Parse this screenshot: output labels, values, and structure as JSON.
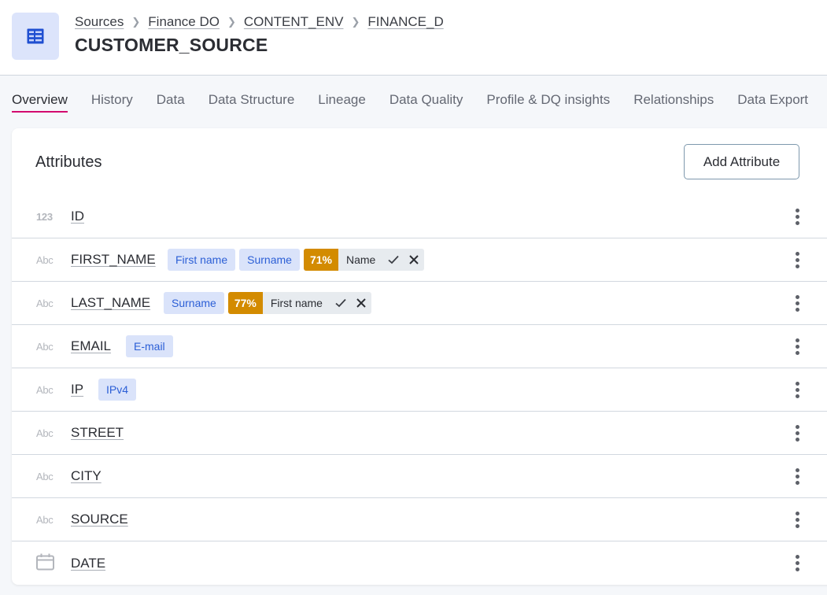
{
  "header": {
    "icon": "table-icon",
    "breadcrumb": [
      "Sources",
      "Finance DO",
      "CONTENT_ENV",
      "FINANCE_D"
    ],
    "title": "CUSTOMER_SOURCE"
  },
  "tabs": [
    {
      "label": "Overview",
      "active": true
    },
    {
      "label": "History"
    },
    {
      "label": "Data"
    },
    {
      "label": "Data Structure"
    },
    {
      "label": "Lineage"
    },
    {
      "label": "Data Quality"
    },
    {
      "label": "Profile & DQ insights"
    },
    {
      "label": "Relationships"
    },
    {
      "label": "Data Export"
    }
  ],
  "attributes_panel": {
    "title": "Attributes",
    "add_button": "Add Attribute",
    "rows": [
      {
        "type": "123",
        "type_icon": "integer-icon",
        "name": "ID",
        "terms": [],
        "suggestion": null
      },
      {
        "type": "Abc",
        "type_icon": "string-icon",
        "name": "FIRST_NAME",
        "terms": [
          "First name",
          "Surname"
        ],
        "suggestion": {
          "confidence": "71%",
          "term": "Name"
        }
      },
      {
        "type": "Abc",
        "type_icon": "string-icon",
        "name": "LAST_NAME",
        "terms": [
          "Surname"
        ],
        "suggestion": {
          "confidence": "77%",
          "term": "First name"
        }
      },
      {
        "type": "Abc",
        "type_icon": "string-icon",
        "name": "EMAIL",
        "terms": [
          "E-mail"
        ],
        "suggestion": null
      },
      {
        "type": "Abc",
        "type_icon": "string-icon",
        "name": "IP",
        "terms": [
          "IPv4"
        ],
        "suggestion": null
      },
      {
        "type": "Abc",
        "type_icon": "string-icon",
        "name": "STREET",
        "terms": [],
        "suggestion": null
      },
      {
        "type": "Abc",
        "type_icon": "string-icon",
        "name": "CITY",
        "terms": [],
        "suggestion": null
      },
      {
        "type": "Abc",
        "type_icon": "string-icon",
        "name": "SOURCE",
        "terms": [],
        "suggestion": null
      },
      {
        "type": "",
        "type_icon": "calendar-icon",
        "name": "DATE",
        "terms": [],
        "suggestion": null
      }
    ]
  },
  "colors": {
    "accent_tab": "#d20a6e",
    "chip_bg": "#dae3fa",
    "chip_text": "#2c5fd6",
    "confidence_bg": "#d38b00"
  }
}
